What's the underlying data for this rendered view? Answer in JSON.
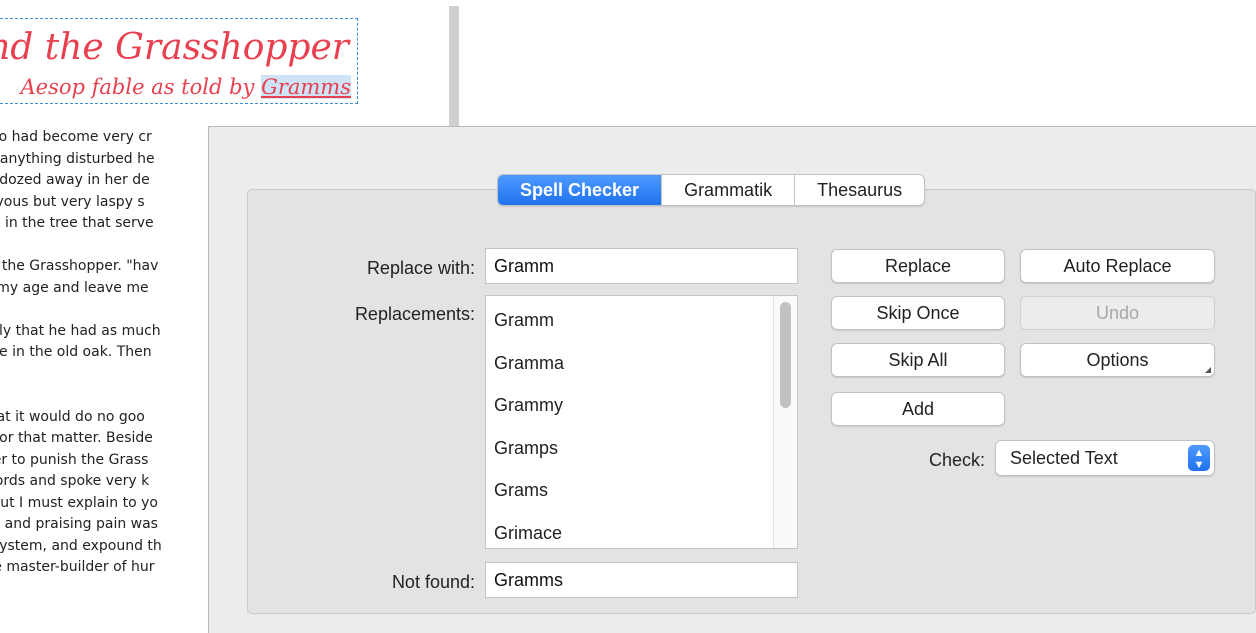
{
  "document": {
    "title": "and the Grasshopper",
    "subtitle_prefix": "Aesop fable as told by ",
    "subtitle_highlight": "Gramms",
    "lines": [
      "l who had become very cr",
      "ly if anything disturbed he",
      "she dozed away in her de",
      "a joyous but very laspy s",
      "hing in the tree that serve",
      "",
      "d to the Grasshopper. \"hav",
      "ect my age and leave me",
      "",
      "aucily that he had as much",
      "place in the old oak. Then",
      ".",
      "",
      "ll that it would do no goo",
      "lse for that matter. Beside",
      "it her to punish the Grass",
      "d words and spoke very k",
      "ns.But I must explain to yo",
      "sure and praising pain was",
      "he system, and expound th",
      ", the master-builder of hur"
    ]
  },
  "spell_panel": {
    "tabs": [
      {
        "label": "Spell Checker",
        "active": true
      },
      {
        "label": "Grammatik",
        "active": false
      },
      {
        "label": "Thesaurus",
        "active": false
      }
    ],
    "replace_with_label": "Replace with:",
    "replace_with_value": "Gramm",
    "replacements_label": "Replacements:",
    "replacements": [
      "Gramm",
      "Gramma",
      "Grammy",
      "Gramps",
      "Grams",
      "Grimace"
    ],
    "not_found_label": "Not found:",
    "not_found_value": "Gramms",
    "buttons": {
      "replace": "Replace",
      "auto_replace": "Auto Replace",
      "skip_once": "Skip Once",
      "undo": "Undo",
      "skip_all": "Skip All",
      "options": "Options",
      "add": "Add"
    },
    "check_label": "Check:",
    "check_value": "Selected Text",
    "accent_color": "#1f71f0",
    "text_accent_color": "#e8404f"
  }
}
